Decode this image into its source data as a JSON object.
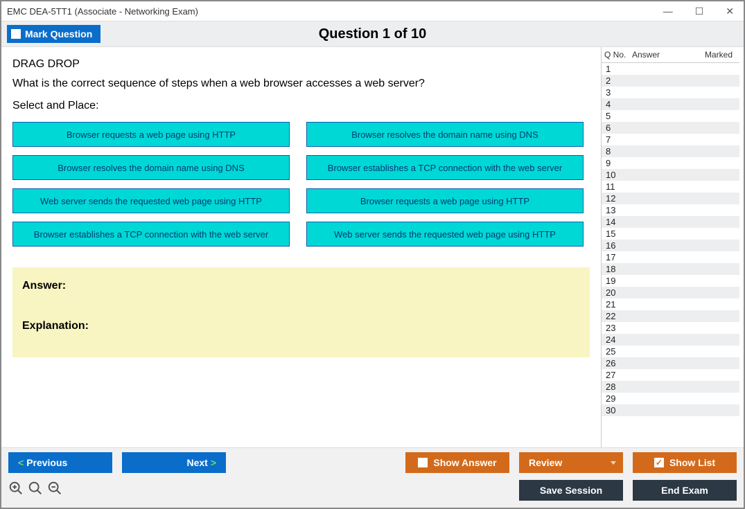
{
  "window": {
    "title": "EMC DEA-5TT1 (Associate - Networking Exam)"
  },
  "header": {
    "mark_label": "Mark Question",
    "question_title": "Question 1 of 10"
  },
  "question": {
    "type": "DRAG DROP",
    "prompt": "What is the correct sequence of steps when a web browser accesses a web server?",
    "instruction": "Select and Place:",
    "left_col": [
      "Browser requests a web page using HTTP",
      "Browser resolves the domain name using DNS",
      "Web server sends the requested web page using HTTP",
      "Browser establishes a TCP connection with the web server"
    ],
    "right_col": [
      "Browser resolves the domain name using DNS",
      "Browser establishes a TCP connection with the web server",
      "Browser requests a web page using HTTP",
      "Web server sends the requested web page using HTTP"
    ],
    "answer_label": "Answer:",
    "explanation_label": "Explanation:"
  },
  "qlist": {
    "col_qno": "Q No.",
    "col_answer": "Answer",
    "col_marked": "Marked",
    "rows": [
      "1",
      "2",
      "3",
      "4",
      "5",
      "6",
      "7",
      "8",
      "9",
      "10",
      "11",
      "12",
      "13",
      "14",
      "15",
      "16",
      "17",
      "18",
      "19",
      "20",
      "21",
      "22",
      "23",
      "24",
      "25",
      "26",
      "27",
      "28",
      "29",
      "30"
    ]
  },
  "footer": {
    "previous": "Previous",
    "next": "Next",
    "show_answer": "Show Answer",
    "review": "Review",
    "show_list": "Show List",
    "save_session": "Save Session",
    "end_exam": "End Exam"
  }
}
